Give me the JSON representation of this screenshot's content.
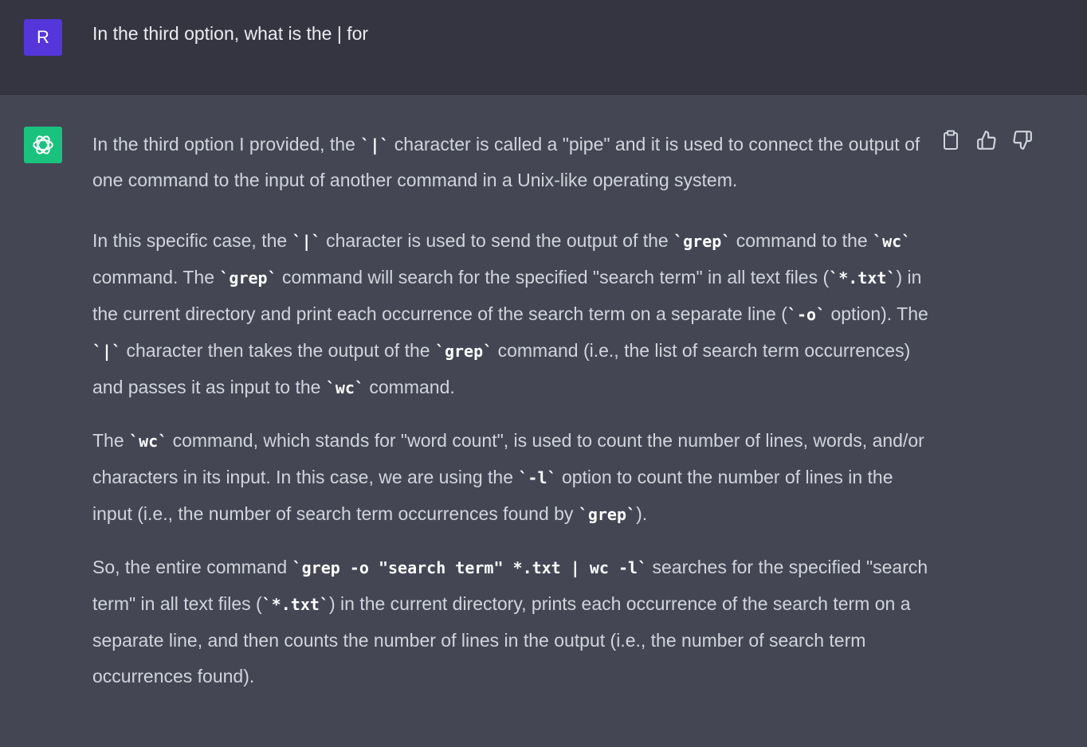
{
  "user": {
    "avatar_letter": "R",
    "message": "In the third option, what is the | for"
  },
  "assistant": {
    "actions": [
      "copy-icon",
      "thumbs-up-icon",
      "thumbs-down-icon"
    ],
    "paragraphs": [
      [
        {
          "t": "In the third option I provided, the "
        },
        {
          "c": "`|`"
        },
        {
          "t": " character is called a \"pipe\" and it is used to connect the output of one command to the input of another command in a Unix-like operating system."
        }
      ],
      [
        {
          "t": "In this specific case, the "
        },
        {
          "c": "`|`"
        },
        {
          "t": " character is used to send the output of the "
        },
        {
          "c": "`grep`"
        },
        {
          "t": " command to the "
        },
        {
          "c": "`wc`"
        },
        {
          "t": " command. The "
        },
        {
          "c": "`grep`"
        },
        {
          "t": " command will search for the specified \"search term\" in all text files ("
        },
        {
          "c": "`*.txt`"
        },
        {
          "t": ") in the current directory and print each occurrence of the search term on a separate line ("
        },
        {
          "c": "`-o`"
        },
        {
          "t": " option). The "
        },
        {
          "c": "`|`"
        },
        {
          "t": " character then takes the output of the "
        },
        {
          "c": "`grep`"
        },
        {
          "t": " command (i.e., the list of search term occurrences) and passes it as input to the "
        },
        {
          "c": "`wc`"
        },
        {
          "t": " command."
        }
      ],
      [
        {
          "t": "The "
        },
        {
          "c": "`wc`"
        },
        {
          "t": " command, which stands for \"word count\", is used to count the number of lines, words, and/or characters in its input. In this case, we are using the "
        },
        {
          "c": "`-l`"
        },
        {
          "t": " option to count the number of lines in the input (i.e., the number of search term occurrences found by "
        },
        {
          "c": "`grep`"
        },
        {
          "t": ")."
        }
      ],
      [
        {
          "t": "So, the entire command "
        },
        {
          "c": "`grep -o \"search term\" *.txt | wc -l`"
        },
        {
          "t": " searches for the specified \"search term\" in all text files ("
        },
        {
          "c": "`*.txt`"
        },
        {
          "t": ") in the current directory, prints each occurrence of the search term on a separate line, and then counts the number of lines in the output (i.e., the number of search term occurrences found)."
        }
      ]
    ]
  }
}
